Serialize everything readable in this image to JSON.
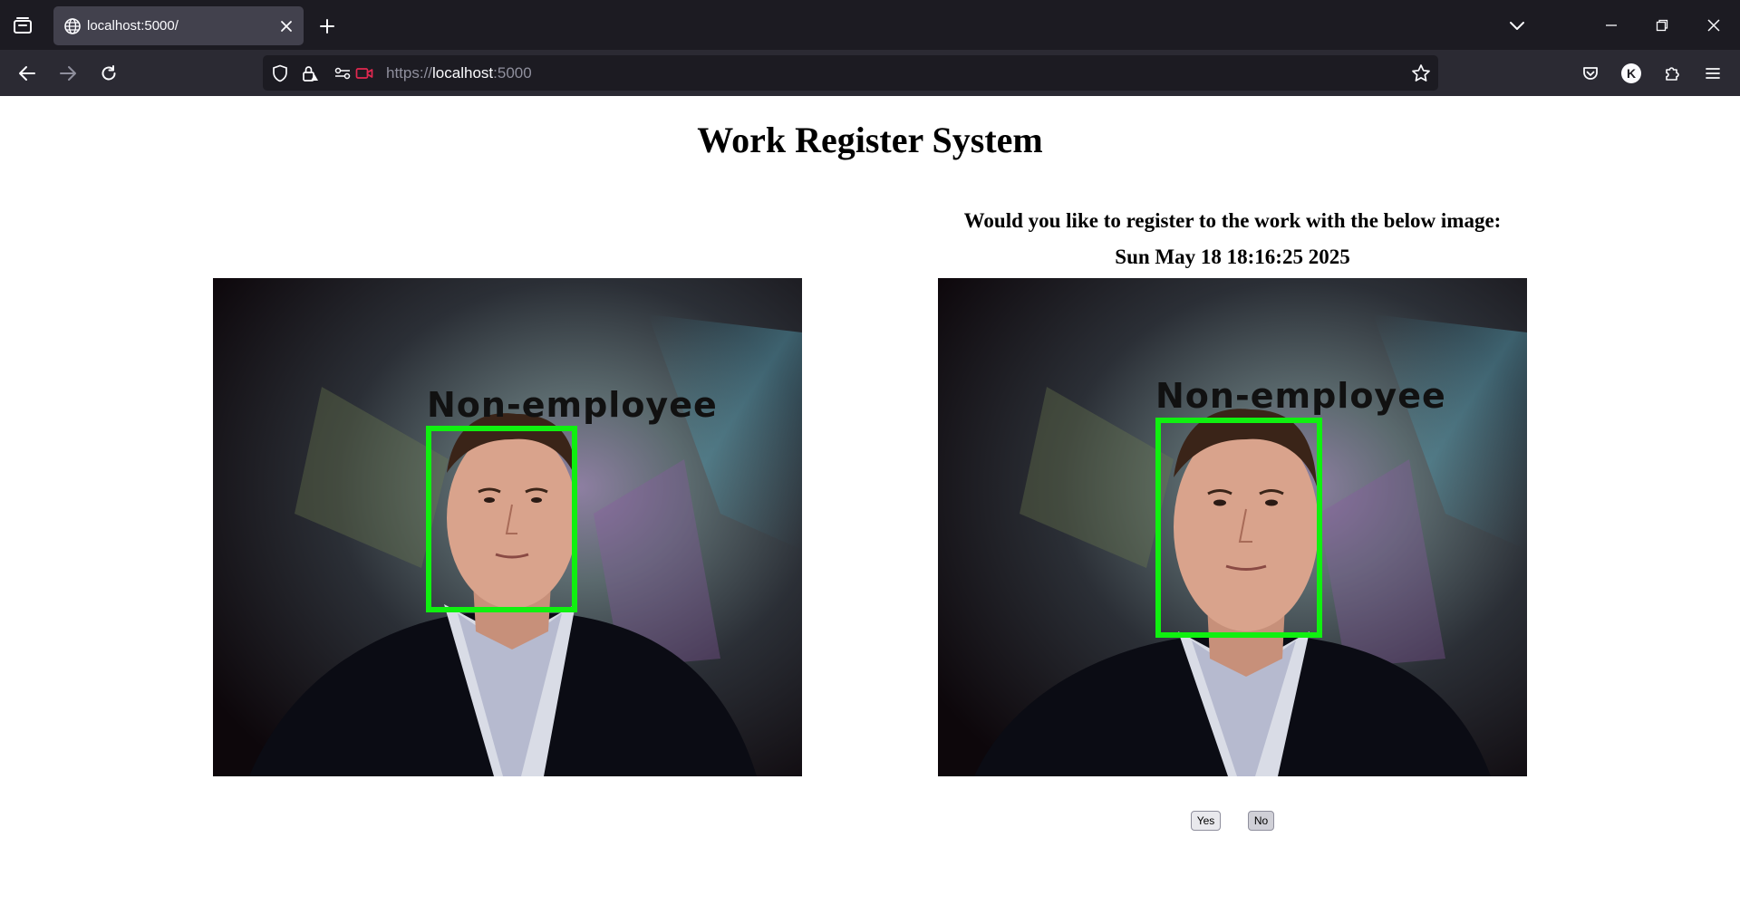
{
  "browser": {
    "tab": {
      "title": "localhost:5000/"
    },
    "url": {
      "scheme": "https://",
      "host": "localhost",
      "port": ":5000"
    },
    "account_initial": "K"
  },
  "page": {
    "title": "Work Register System",
    "prompt": "Would you like to register to the work with the below image:",
    "timestamp": "Sun May 18 18:16:25 2025",
    "left_frame": {
      "face_label": "Non-employee"
    },
    "right_frame": {
      "face_label": "Non-employee"
    },
    "buttons": {
      "yes": "Yes",
      "no": "No"
    }
  },
  "colors": {
    "face_box": "#10f010",
    "chrome_dark": "#1c1b22",
    "chrome_toolbar": "#2b2a33"
  }
}
